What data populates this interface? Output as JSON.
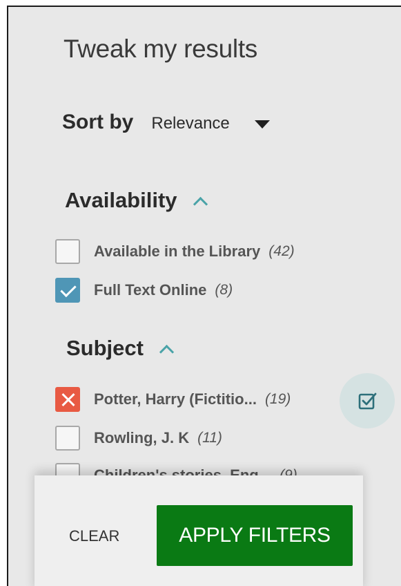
{
  "panel": {
    "title": "Tweak my results"
  },
  "sort": {
    "label": "Sort by",
    "selected": "Relevance",
    "icon": "caret-down-icon"
  },
  "availability": {
    "title": "Availability",
    "icon": "chevron-up-icon",
    "items": [
      {
        "label": "Available in the Library",
        "count": "(42)",
        "state": "unchecked"
      },
      {
        "label": "Full Text Online",
        "count": "(8)",
        "state": "checked"
      }
    ]
  },
  "subject": {
    "title": "Subject",
    "icon": "chevron-up-icon",
    "items": [
      {
        "label": "Potter, Harry (Fictitio...",
        "count": "(19)",
        "state": "excluded"
      },
      {
        "label": "Rowling, J. K",
        "count": "(11)",
        "state": "unchecked"
      },
      {
        "label": "Children's stories, Eng...",
        "count": "(9)",
        "state": "unchecked"
      }
    ],
    "multi_select_icon": "multi-select-checkbox-icon"
  },
  "footer": {
    "clear_label": "CLEAR",
    "apply_label": "APPLY FILTERS"
  },
  "colors": {
    "panel_bg": "#e8e8e8",
    "checked": "#4f96b6",
    "excluded": "#e85a43",
    "accent": "#4aa3a8",
    "apply_bg": "#0a7a14"
  }
}
